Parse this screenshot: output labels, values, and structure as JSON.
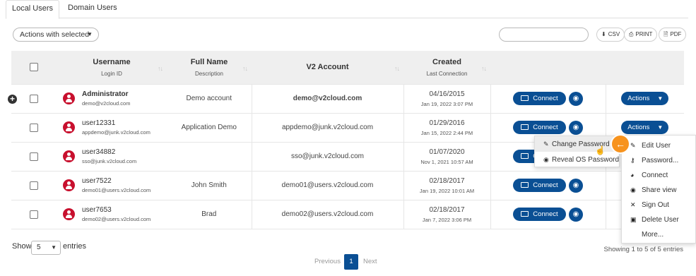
{
  "tabs": [
    {
      "label": "Local Users"
    },
    {
      "label": "Domain Users"
    }
  ],
  "toolbar": {
    "actions_with_selected": "Actions with selected",
    "search_placeholder": "",
    "csv_label": "CSV",
    "print_label": "PRINT",
    "pdf_label": "PDF"
  },
  "table": {
    "headers": {
      "username": "Username",
      "login_id": "Login ID",
      "full_name": "Full Name",
      "description": "Description",
      "v2_account": "V2 Account",
      "created": "Created",
      "last_connection": "Last Connection"
    },
    "rows": [
      {
        "name": "Administrator",
        "email": "demo@v2cloud.com",
        "full_name": "Demo account",
        "v2": "demo@v2cloud.com",
        "created": "04/16/2015",
        "last": "Jan 19, 2022 3:07 PM"
      },
      {
        "name": "user12331",
        "email": "appdemo@junk.v2cloud.com",
        "full_name": "Application Demo",
        "v2": "appdemo@junk.v2cloud.com",
        "created": "01/29/2016",
        "last": "Jan 15, 2022 2:44 PM"
      },
      {
        "name": "user34882",
        "email": "sso@junk.v2cloud.com",
        "full_name": "",
        "v2": "sso@junk.v2cloud.com",
        "created": "01/07/2020",
        "last": "Nov 1, 2021 10:57 AM"
      },
      {
        "name": "user7522",
        "email": "demo01@users.v2cloud.com",
        "full_name": "John Smith",
        "v2": "demo01@users.v2cloud.com",
        "created": "02/18/2017",
        "last": "Jan 19, 2022 10:01 AM"
      },
      {
        "name": "user7653",
        "email": "demo02@users.v2cloud.com",
        "full_name": "Brad",
        "v2": "demo02@users.v2cloud.com",
        "created": "02/18/2017",
        "last": "Jan 7, 2022 3:06 PM"
      }
    ],
    "connect_label": "Connect",
    "actions_label": "Actions"
  },
  "submenu": {
    "change_password": "Change Password",
    "reveal_os_password": "Reveal OS Password"
  },
  "actions_menu": {
    "edit_user": "Edit User",
    "password": "Password...",
    "connect": "Connect",
    "share_view": "Share view",
    "sign_out": "Sign Out",
    "delete_user": "Delete User",
    "more": "More..."
  },
  "footer": {
    "show": "Show",
    "page_size": "5",
    "entries": "entries",
    "showing": "Showing 1 to 5 of 5 entries",
    "previous": "Previous",
    "page": "1",
    "next": "Next"
  },
  "colors": {
    "primary": "#0a4f94",
    "avatar": "#c8102e",
    "highlight": "#f7931e"
  }
}
